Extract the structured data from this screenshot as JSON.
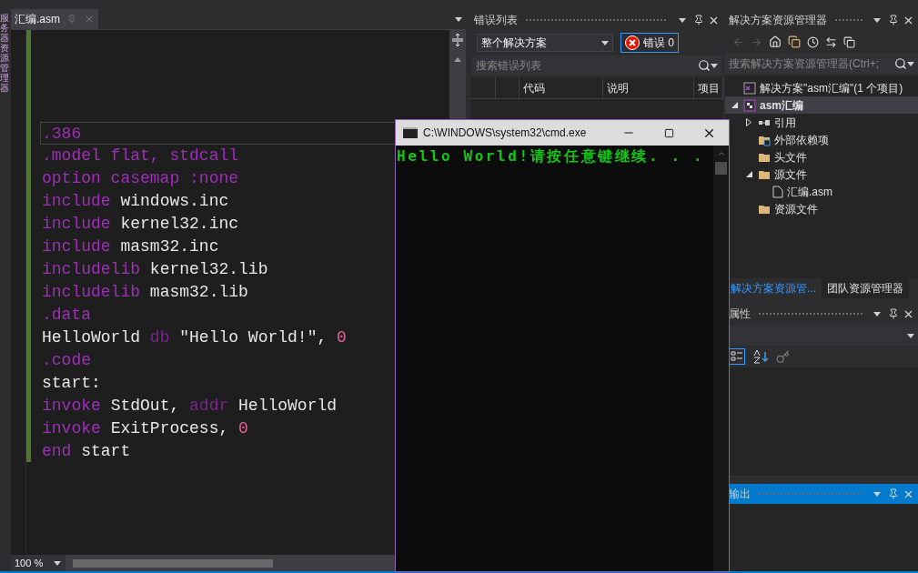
{
  "left_strip": {
    "label": "服务器资源管理器"
  },
  "editor": {
    "tab": {
      "title": "汇编.asm",
      "selected": true
    },
    "lines": [
      {
        "current": true,
        "tokens": [
          {
            "text": ".386",
            "kind": "keyword"
          }
        ]
      },
      {
        "current": false,
        "tokens": [
          {
            "text": ".model flat, stdcall",
            "kind": "keyword"
          }
        ]
      },
      {
        "current": false,
        "tokens": [
          {
            "text": "option casemap ",
            "kind": "keyword"
          },
          {
            "text": ":none",
            "kind": "keyword"
          }
        ]
      },
      {
        "current": false,
        "tokens": [
          {
            "text": "include ",
            "kind": "keyword"
          },
          {
            "text": "windows.inc",
            "kind": "text"
          }
        ]
      },
      {
        "current": false,
        "tokens": [
          {
            "text": "include ",
            "kind": "keyword"
          },
          {
            "text": "kernel32.inc",
            "kind": "text"
          }
        ]
      },
      {
        "current": false,
        "tokens": [
          {
            "text": "include ",
            "kind": "keyword"
          },
          {
            "text": "masm32.inc",
            "kind": "text"
          }
        ]
      },
      {
        "current": false,
        "tokens": [
          {
            "text": "includelib ",
            "kind": "keyword"
          },
          {
            "text": "kernel32.lib",
            "kind": "text"
          }
        ]
      },
      {
        "current": false,
        "tokens": [
          {
            "text": "includelib ",
            "kind": "keyword"
          },
          {
            "text": "masm32.lib",
            "kind": "text"
          }
        ]
      },
      {
        "current": false,
        "tokens": [
          {
            "text": ".data",
            "kind": "keyword"
          }
        ]
      },
      {
        "current": false,
        "tokens": [
          {
            "text": "HelloWorld ",
            "kind": "text"
          },
          {
            "text": "db ",
            "kind": "operator"
          },
          {
            "text": "\"Hello World!\", ",
            "kind": "text"
          },
          {
            "text": "0",
            "kind": "number"
          }
        ]
      },
      {
        "current": false,
        "tokens": [
          {
            "text": ".code",
            "kind": "keyword"
          }
        ]
      },
      {
        "current": false,
        "tokens": [
          {
            "text": "start:",
            "kind": "text"
          }
        ]
      },
      {
        "current": false,
        "tokens": [
          {
            "text": "invoke ",
            "kind": "keyword"
          },
          {
            "text": "StdOut, ",
            "kind": "text"
          },
          {
            "text": "addr ",
            "kind": "operator"
          },
          {
            "text": "HelloWorld",
            "kind": "text"
          }
        ]
      },
      {
        "current": false,
        "tokens": [
          {
            "text": "invoke ",
            "kind": "keyword"
          },
          {
            "text": "ExitProcess, ",
            "kind": "text"
          },
          {
            "text": "0",
            "kind": "number"
          }
        ]
      },
      {
        "current": false,
        "tokens": [
          {
            "text": "end ",
            "kind": "keyword"
          },
          {
            "text": "start",
            "kind": "text"
          }
        ]
      }
    ],
    "zoom": "100 %"
  },
  "error_list": {
    "title": "错误列表",
    "scope": "整个解决方案",
    "errors_button": "错误 0",
    "search": {
      "placeholder": "搜索错误列表"
    },
    "columns": [
      "代码",
      "说明",
      "项目"
    ]
  },
  "solution_explorer": {
    "title": "解决方案资源管理器",
    "search": {
      "placeholder": "搜索解决方案资源管理器(Ctrl+;"
    },
    "tree": [
      {
        "label": "解决方案\"asm汇编\"(1 个项目)",
        "kind": "solution",
        "selected": false
      },
      {
        "label": "asm汇编",
        "kind": "project",
        "selected": true,
        "expanded": true,
        "children": [
          {
            "label": "引用",
            "kind": "reference",
            "selected": false,
            "expanded": false
          },
          {
            "label": "外部依赖项",
            "kind": "linkfolder",
            "selected": false
          },
          {
            "label": "头文件",
            "kind": "folder",
            "selected": false
          },
          {
            "label": "源文件",
            "kind": "folder",
            "selected": false,
            "expanded": true,
            "children": [
              {
                "label": "汇编.asm",
                "kind": "file",
                "selected": false
              }
            ]
          },
          {
            "label": "资源文件",
            "kind": "folder",
            "selected": false
          }
        ]
      }
    ],
    "tabs": [
      {
        "label": "解决方案资源管...",
        "selected": true
      },
      {
        "label": "团队资源管理器",
        "selected": false
      }
    ]
  },
  "properties": {
    "title": "属性"
  },
  "output": {
    "title": "输出",
    "active": true
  },
  "console": {
    "title": "C:\\WINDOWS\\system32\\cmd.exe",
    "lines": [
      "Hello World!请按任意键继续. . ."
    ]
  }
}
